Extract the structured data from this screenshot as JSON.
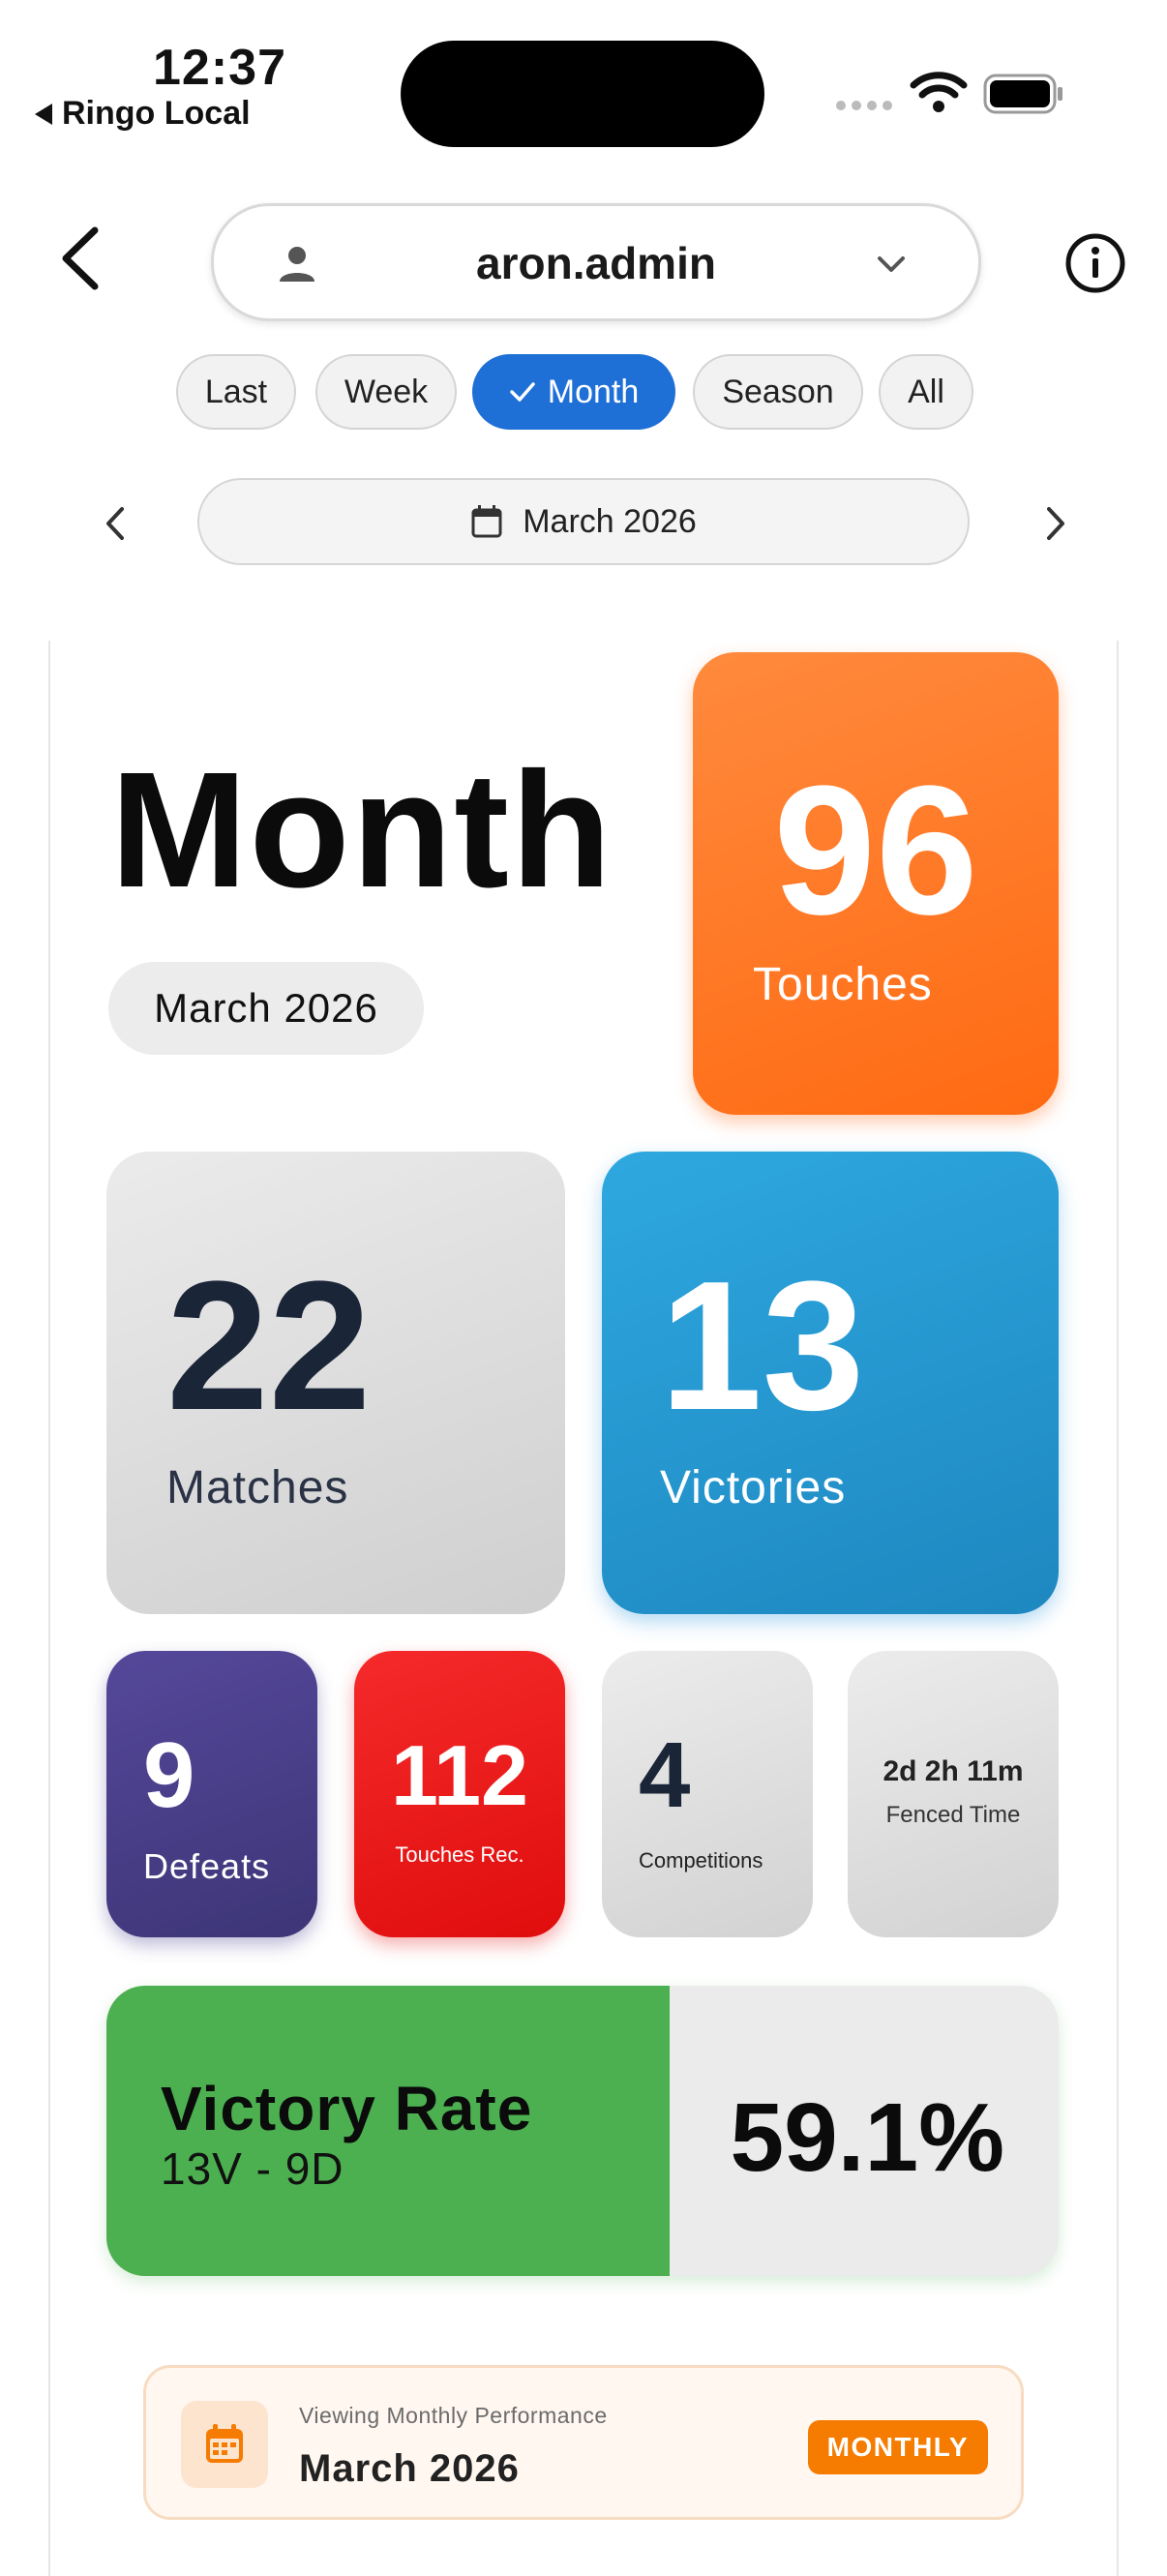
{
  "status_bar": {
    "time": "12:37",
    "back_label": "Ringo Local"
  },
  "header": {
    "username": "aron.admin",
    "icons": {
      "back": "chevron-left-icon",
      "user": "person-icon",
      "caret": "chevron-down-icon",
      "info": "info-icon"
    }
  },
  "period_tabs": [
    {
      "label": "Last",
      "active": false
    },
    {
      "label": "Week",
      "active": false
    },
    {
      "label": "Month",
      "active": true
    },
    {
      "label": "Season",
      "active": false
    },
    {
      "label": "All",
      "active": false
    }
  ],
  "date_nav": {
    "label": "March 2026"
  },
  "summary": {
    "title": "Month",
    "period": "March 2026"
  },
  "stats": {
    "touches": {
      "value": "96",
      "label": "Touches",
      "color": "#ff7a25"
    },
    "matches": {
      "value": "22",
      "label": "Matches"
    },
    "victories": {
      "value": "13",
      "label": "Victories",
      "color": "#2699d6"
    },
    "defeats": {
      "value": "9",
      "label": "Defeats",
      "color": "#4a4088"
    },
    "touches_received": {
      "value": "112",
      "label": "Touches Rec.",
      "color": "#ee1b1b"
    },
    "competitions": {
      "value": "4",
      "label": "Competitions"
    },
    "fenced_time": {
      "value": "2d 2h 11m",
      "label": "Fenced Time"
    }
  },
  "victory_rate": {
    "title": "Victory Rate",
    "record": "13V - 9D",
    "value": "59.1%",
    "fraction": 0.591,
    "color": "#4caf50"
  },
  "banner": {
    "caption": "Viewing Monthly Performance",
    "month": "March 2026",
    "badge": "MONTHLY",
    "accent": "#f57c00"
  }
}
